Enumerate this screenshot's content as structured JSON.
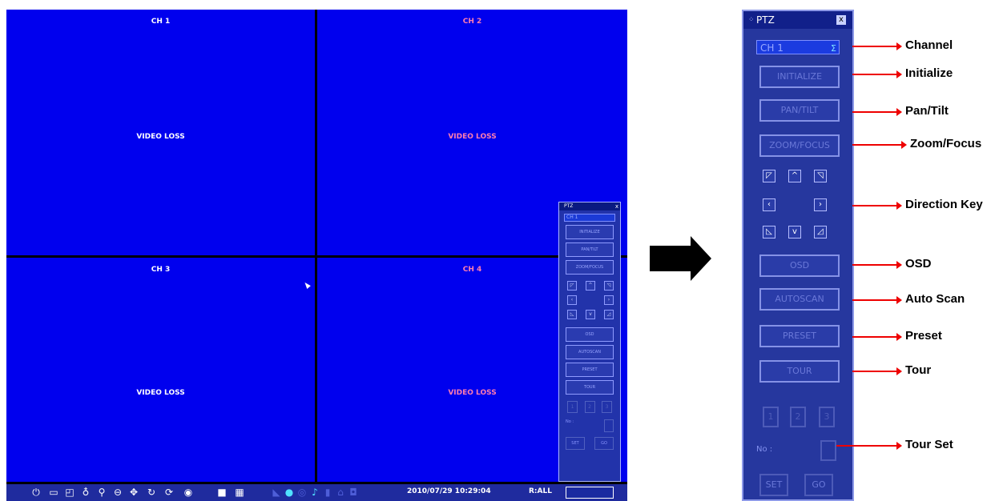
{
  "dvr": {
    "channels": [
      {
        "title": "CH 1",
        "status": "VIDEO LOSS"
      },
      {
        "title": "CH 2",
        "status": "VIDEO LOSS"
      },
      {
        "title": "CH 3",
        "status": "VIDEO LOSS"
      },
      {
        "title": "CH 4",
        "status": "VIDEO LOSS"
      }
    ],
    "mini_ptz": {
      "title": "PTZ",
      "close": "x",
      "channel": "CH 1",
      "buttons": [
        "INITIALIZE",
        "PAN/TILT",
        "ZOOM/FOCUS",
        "OSD",
        "AUTOSCAN",
        "PRESET",
        "TOUR"
      ],
      "numbers": [
        "1",
        "2",
        "3"
      ],
      "no_label": "No :",
      "set": "SET",
      "go": "GO"
    },
    "taskbar": {
      "datetime": "2010/07/29 10:29:04",
      "record_mode": "R:ALL",
      "icons": [
        "power-icon",
        "menu-icon",
        "search-icon",
        "mic-icon",
        "zoom-icon",
        "pip-icon",
        "ptz-icon",
        "rotate-icon",
        "sequence-icon",
        "alarm-icon",
        "single-layout-icon",
        "quad-layout-icon",
        "camera-icon",
        "network-icon",
        "record-icon",
        "audio-icon",
        "lock-icon",
        "logout-icon",
        "disk-icon"
      ]
    }
  },
  "ptz": {
    "title": "PTZ",
    "close": "x",
    "channel_value": "CH 1",
    "initialize": "INITIALIZE",
    "pan_tilt": "PAN/TILT",
    "zoom_focus": "ZOOM/FOCUS",
    "osd": "OSD",
    "autoscan": "AUTOSCAN",
    "preset": "PRESET",
    "tour": "TOUR",
    "tour_numbers": [
      "1",
      "2",
      "3"
    ],
    "no_label": "No :",
    "set": "SET",
    "go": "GO"
  },
  "callouts": {
    "channel": "Channel",
    "initialize": "Initialize",
    "pan_tilt": "Pan/Tilt",
    "zoom_focus": "Zoom/Focus",
    "direction_key": "Direction Key",
    "osd": "OSD",
    "auto_scan": "Auto Scan",
    "preset": "Preset",
    "tour": "Tour",
    "tour_set": "Tour Set"
  },
  "colors": {
    "channel_bg": "#0000ee",
    "panel_bg": "#26379e",
    "callout": "#ee0000"
  }
}
